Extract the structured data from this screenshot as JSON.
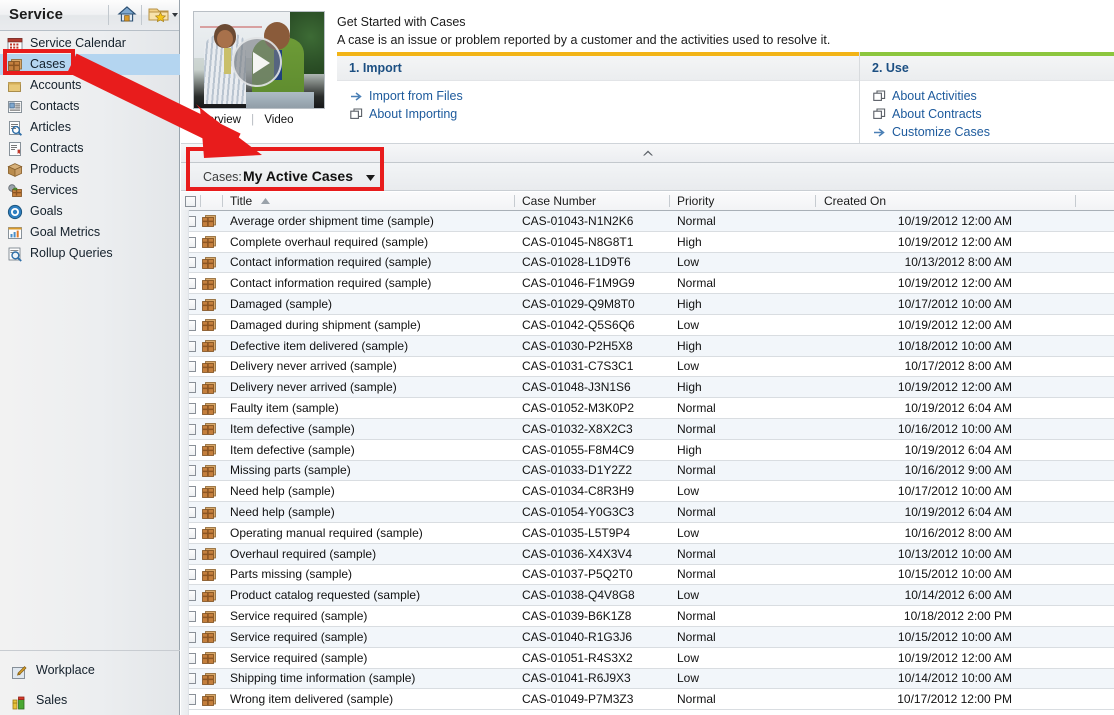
{
  "sidebar": {
    "title": "Service",
    "header_buttons": [
      {
        "name": "home-button",
        "icon": "home-icon",
        "label": "Home"
      },
      {
        "name": "favorites-button",
        "icon": "folder-star-icon",
        "label": "Favorites"
      }
    ],
    "items": [
      {
        "label": "Service Calendar",
        "icon": "calendar-icon",
        "selected": false
      },
      {
        "label": "Cases",
        "icon": "case-icon",
        "selected": true
      },
      {
        "label": "Accounts",
        "icon": "accounts-icon",
        "selected": false
      },
      {
        "label": "Contacts",
        "icon": "contacts-icon",
        "selected": false
      },
      {
        "label": "Articles",
        "icon": "article-icon",
        "selected": false
      },
      {
        "label": "Contracts",
        "icon": "contract-icon",
        "selected": false
      },
      {
        "label": "Products",
        "icon": "product-box-icon",
        "selected": false
      },
      {
        "label": "Services",
        "icon": "services-icon",
        "selected": false
      },
      {
        "label": "Goals",
        "icon": "goal-target-icon",
        "selected": false
      },
      {
        "label": "Goal Metrics",
        "icon": "goal-metrics-icon",
        "selected": false
      },
      {
        "label": "Rollup Queries",
        "icon": "rollup-query-icon",
        "selected": false
      }
    ],
    "bottom_items": [
      {
        "label": "Workplace",
        "icon": "workplace-icon"
      },
      {
        "label": "Sales",
        "icon": "sales-icon"
      }
    ]
  },
  "get_started": {
    "title": "Get Started with Cases",
    "subtitle": "A case is an issue or problem reported by a customer and the activities used to resolve it.",
    "thumbnail": {
      "overview_label": "Overview",
      "video_label": "Video",
      "play_icon": "play-icon"
    },
    "steps": [
      {
        "heading": "1. Import",
        "bar_color": "#f2b417",
        "links": [
          {
            "label": "Import from Files",
            "icon": "arrow-link-icon"
          },
          {
            "label": "About Importing",
            "icon": "window-link-icon"
          }
        ]
      },
      {
        "heading": "2. Use",
        "bar_color": "#8cc63e",
        "links": [
          {
            "label": "About Activities",
            "icon": "window-link-icon"
          },
          {
            "label": "About Contracts",
            "icon": "window-link-icon"
          },
          {
            "label": "Customize Cases",
            "icon": "arrow-link-icon"
          }
        ]
      }
    ],
    "collapse_icon": "chevron-up-icon"
  },
  "view_selector": {
    "entity_label": "Cases:",
    "selected_view": "My Active Cases",
    "caret_icon": "chevron-down-icon"
  },
  "grid": {
    "columns": [
      "Title",
      "Case Number",
      "Priority",
      "Created On"
    ],
    "sort_column": "Title",
    "sort_direction": "asc",
    "row_icon": "case-record-icon",
    "rows": [
      {
        "title": "Average order shipment time (sample)",
        "number": "CAS-01043-N1N2K6",
        "priority": "Normal",
        "created": "10/19/2012 12:00 AM"
      },
      {
        "title": "Complete overhaul required (sample)",
        "number": "CAS-01045-N8G8T1",
        "priority": "High",
        "created": "10/19/2012 12:00 AM"
      },
      {
        "title": "Contact information required (sample)",
        "number": "CAS-01028-L1D9T6",
        "priority": "Low",
        "created": "10/13/2012 8:00 AM"
      },
      {
        "title": "Contact information required (sample)",
        "number": "CAS-01046-F1M9G9",
        "priority": "Normal",
        "created": "10/19/2012 12:00 AM"
      },
      {
        "title": "Damaged (sample)",
        "number": "CAS-01029-Q9M8T0",
        "priority": "High",
        "created": "10/17/2012 10:00 AM"
      },
      {
        "title": "Damaged during shipment (sample)",
        "number": "CAS-01042-Q5S6Q6",
        "priority": "Low",
        "created": "10/19/2012 12:00 AM"
      },
      {
        "title": "Defective item delivered (sample)",
        "number": "CAS-01030-P2H5X8",
        "priority": "High",
        "created": "10/18/2012 10:00 AM"
      },
      {
        "title": "Delivery never arrived (sample)",
        "number": "CAS-01031-C7S3C1",
        "priority": "Low",
        "created": "10/17/2012 8:00 AM"
      },
      {
        "title": "Delivery never arrived (sample)",
        "number": "CAS-01048-J3N1S6",
        "priority": "High",
        "created": "10/19/2012 12:00 AM"
      },
      {
        "title": "Faulty item (sample)",
        "number": "CAS-01052-M3K0P2",
        "priority": "Normal",
        "created": "10/19/2012 6:04 AM"
      },
      {
        "title": "Item defective (sample)",
        "number": "CAS-01032-X8X2C3",
        "priority": "Normal",
        "created": "10/16/2012 10:00 AM"
      },
      {
        "title": "Item defective (sample)",
        "number": "CAS-01055-F8M4C9",
        "priority": "High",
        "created": "10/19/2012 6:04 AM"
      },
      {
        "title": "Missing parts (sample)",
        "number": "CAS-01033-D1Y2Z2",
        "priority": "Normal",
        "created": "10/16/2012 9:00 AM"
      },
      {
        "title": "Need help (sample)",
        "number": "CAS-01034-C8R3H9",
        "priority": "Low",
        "created": "10/17/2012 10:00 AM"
      },
      {
        "title": "Need help (sample)",
        "number": "CAS-01054-Y0G3C3",
        "priority": "Normal",
        "created": "10/19/2012 6:04 AM"
      },
      {
        "title": "Operating manual required (sample)",
        "number": "CAS-01035-L5T9P4",
        "priority": "Low",
        "created": "10/16/2012 8:00 AM"
      },
      {
        "title": "Overhaul required (sample)",
        "number": "CAS-01036-X4X3V4",
        "priority": "Normal",
        "created": "10/13/2012 10:00 AM"
      },
      {
        "title": "Parts missing (sample)",
        "number": "CAS-01037-P5Q2T0",
        "priority": "Normal",
        "created": "10/15/2012 10:00 AM"
      },
      {
        "title": "Product catalog requested (sample)",
        "number": "CAS-01038-Q4V8G8",
        "priority": "Low",
        "created": "10/14/2012 6:00 AM"
      },
      {
        "title": "Service required (sample)",
        "number": "CAS-01039-B6K1Z8",
        "priority": "Normal",
        "created": "10/18/2012 2:00 PM"
      },
      {
        "title": "Service required (sample)",
        "number": "CAS-01040-R1G3J6",
        "priority": "Normal",
        "created": "10/15/2012 10:00 AM"
      },
      {
        "title": "Service required (sample)",
        "number": "CAS-01051-R4S3X2",
        "priority": "Low",
        "created": "10/19/2012 12:00 AM"
      },
      {
        "title": "Shipping time information (sample)",
        "number": "CAS-01041-R6J9X3",
        "priority": "Low",
        "created": "10/14/2012 10:00 AM"
      },
      {
        "title": "Wrong item delivered (sample)",
        "number": "CAS-01049-P7M3Z3",
        "priority": "Normal",
        "created": "10/17/2012 12:00 PM"
      }
    ]
  },
  "annotations": {
    "color": "#e81c1c",
    "highlight_boxes": [
      "sidebar-item-cases",
      "view-selector"
    ],
    "arrow": {
      "from": "sidebar-item-cases",
      "to": "view-selector"
    }
  }
}
